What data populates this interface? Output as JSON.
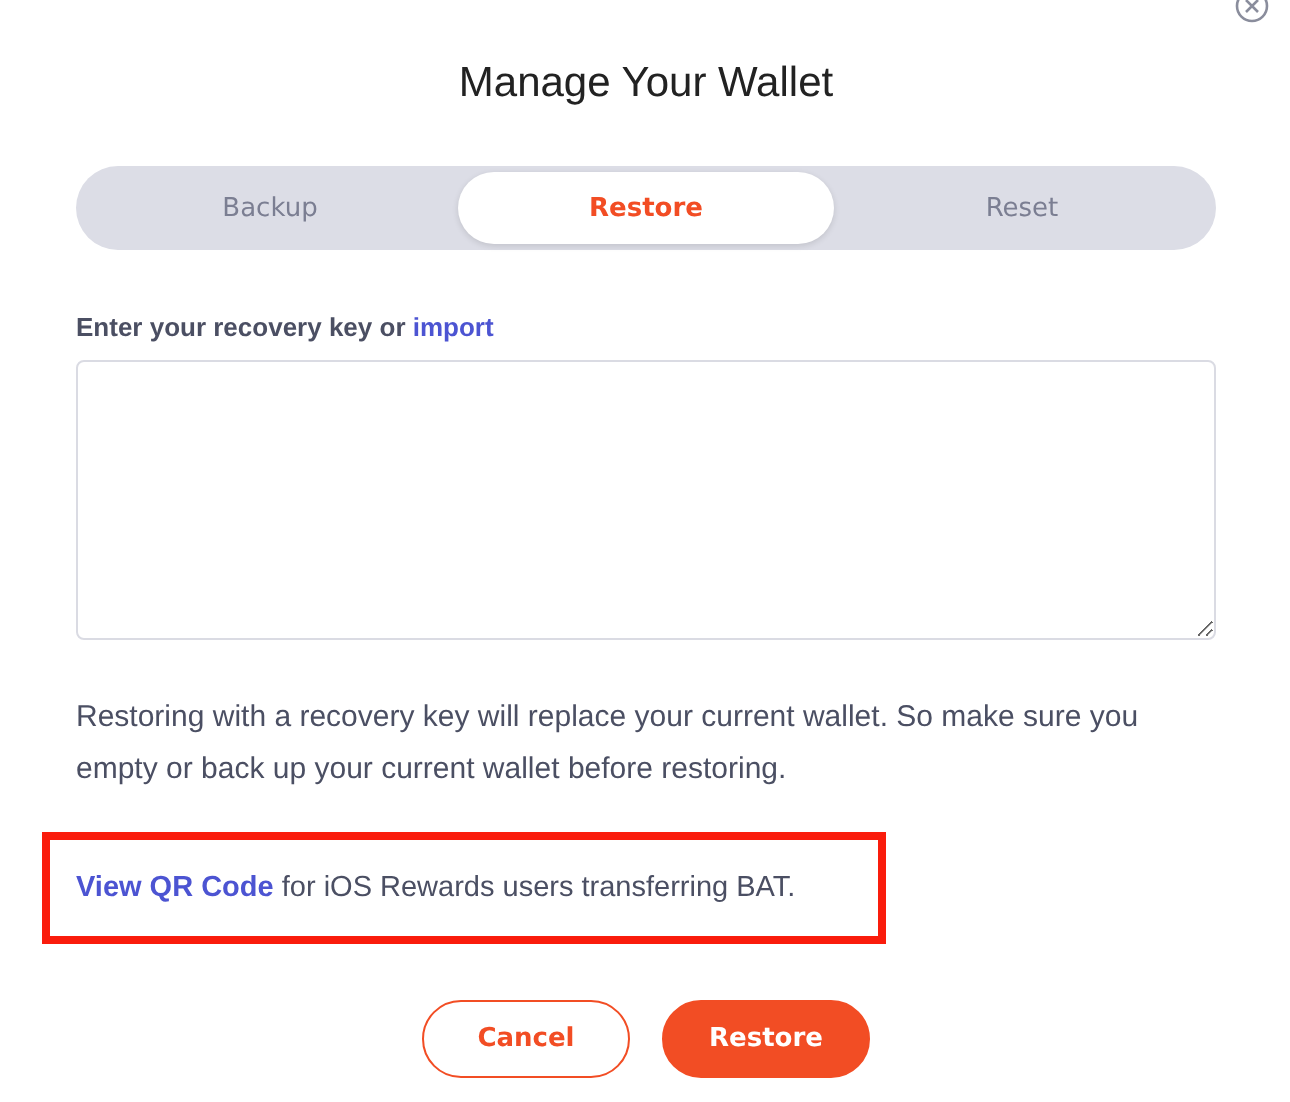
{
  "dialog": {
    "title": "Manage Your Wallet"
  },
  "tabs": [
    {
      "label": "Backup",
      "selected": false
    },
    {
      "label": "Restore",
      "selected": true
    },
    {
      "label": "Reset",
      "selected": false
    }
  ],
  "recovery_field": {
    "label": "Enter your recovery key or",
    "link": "import"
  },
  "warning": "Restoring with a recovery key will replace your current wallet. So make sure you empty or back up your current wallet before restoring.",
  "qr_note": {
    "link": "View QR Code",
    "text": "for iOS Rewards users transferring BAT.",
    "highlighted": true
  },
  "buttons": [
    {
      "label": "Cancel",
      "kind": "secondary"
    },
    {
      "label": "Restore",
      "kind": "primary"
    }
  ]
}
